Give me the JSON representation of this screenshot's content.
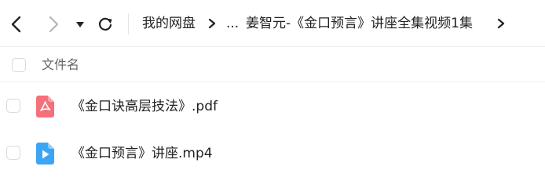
{
  "nav": {
    "back_icon": "chevron-left-icon",
    "forward_icon": "chevron-right-icon",
    "dropdown_icon": "caret-down-icon",
    "refresh_icon": "refresh-icon"
  },
  "breadcrumb": {
    "root": "我的网盘",
    "ellipsis": "...",
    "current": "姜智元-《金口预言》讲座全集视频1集"
  },
  "header": {
    "column_name": "文件名"
  },
  "files": [
    {
      "name": "《金口诀高层技法》.pdf",
      "icon": "pdf-file-icon",
      "icon_color": "#f4707b"
    },
    {
      "name": "《金口预言》讲座.mp4",
      "icon": "video-file-icon",
      "icon_color": "#3aa6f5"
    }
  ],
  "colors": {
    "pdf": "#f4707b",
    "video": "#3aa6f5",
    "text": "#222222",
    "muted": "#666666"
  }
}
